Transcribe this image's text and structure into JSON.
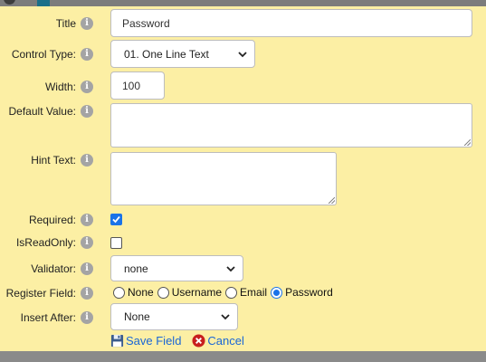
{
  "form": {
    "title": {
      "label": "Title",
      "value": "Password"
    },
    "control_type": {
      "label": "Control Type:",
      "value": "01. One Line Text"
    },
    "width": {
      "label": "Width:",
      "value": "100"
    },
    "default_value": {
      "label": "Default Value:",
      "value": ""
    },
    "hint_text": {
      "label": "Hint Text:",
      "value": ""
    },
    "required": {
      "label": "Required:",
      "checked": true
    },
    "is_read_only": {
      "label": "IsReadOnly:",
      "checked": false
    },
    "validator": {
      "label": "Validator:",
      "value": "none"
    },
    "register_field": {
      "label": "Register Field:",
      "options": [
        "None",
        "Username",
        "Email",
        "Password"
      ],
      "selected": "Password"
    },
    "insert_after": {
      "label": "Insert After:",
      "value": "None"
    }
  },
  "actions": {
    "save": "Save Field",
    "cancel": "Cancel"
  },
  "colors": {
    "background": "#fcefa4",
    "link": "#1a66d6",
    "checkbox": "#1a73e8"
  }
}
